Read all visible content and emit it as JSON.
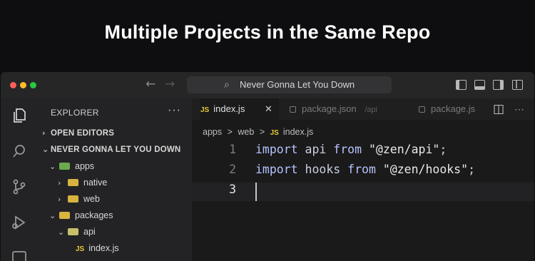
{
  "headline": "Multiple Projects in the Same Repo",
  "colors": {
    "background": "#0e0e10",
    "window": "#1e1e1e",
    "traffic_red": "#ff5f57",
    "traffic_yellow": "#febc2e",
    "traffic_green": "#28c840",
    "js_yellow": "#e8c93a",
    "folder_green": "#6aa84f",
    "folder_yellow": "#d9b340"
  },
  "titlebar": {
    "back_icon": "arrow-left-icon",
    "forward_icon": "arrow-right-icon",
    "back_glyph": "←",
    "forward_glyph": "→",
    "search_icon": "search-icon",
    "search_glyph": "⌕",
    "search_text": "Never Gonna Let You Down"
  },
  "activity_bar": {
    "icons": [
      "files-icon",
      "search-icon",
      "source-control-icon",
      "run-debug-icon",
      "extensions-icon"
    ]
  },
  "sidebar": {
    "title": "EXPLORER",
    "more": "···",
    "open_editors": "OPEN EDITORS",
    "workspace": "NEVER GONNA LET YOU DOWN",
    "items": [
      {
        "label": "apps",
        "kind": "folder-open",
        "color": "#6aa84f"
      },
      {
        "label": "native",
        "kind": "folder",
        "color": "#d9b340"
      },
      {
        "label": "web",
        "kind": "folder",
        "color": "#d9b340"
      },
      {
        "label": "packages",
        "kind": "folder-open",
        "color": "#d9b340"
      },
      {
        "label": "api",
        "kind": "folder-open",
        "color": "#c7c06a"
      },
      {
        "label": "index.js",
        "kind": "js-file",
        "badge": "JS"
      }
    ]
  },
  "editor": {
    "tabs": [
      {
        "badge": "JS",
        "label": "index.js",
        "close": "✕"
      },
      {
        "label": "package.json",
        "path": "/api"
      },
      {
        "label": "package.js"
      }
    ],
    "split_icon": "split-editor-icon",
    "split_glyph": "◫",
    "breadcrumb": {
      "parts": [
        "apps",
        "web",
        "index.js"
      ],
      "sep": ">",
      "badge": "JS"
    },
    "lines": [
      {
        "num": "1",
        "kw1": "import",
        "name": "api",
        "kw2": "from",
        "str": "\"@zen/api\"",
        "end": ";"
      },
      {
        "num": "2",
        "kw1": "import",
        "name": "hooks",
        "kw2": "from",
        "str": "\"@zen/hooks\"",
        "end": ";"
      },
      {
        "num": "3"
      }
    ]
  }
}
